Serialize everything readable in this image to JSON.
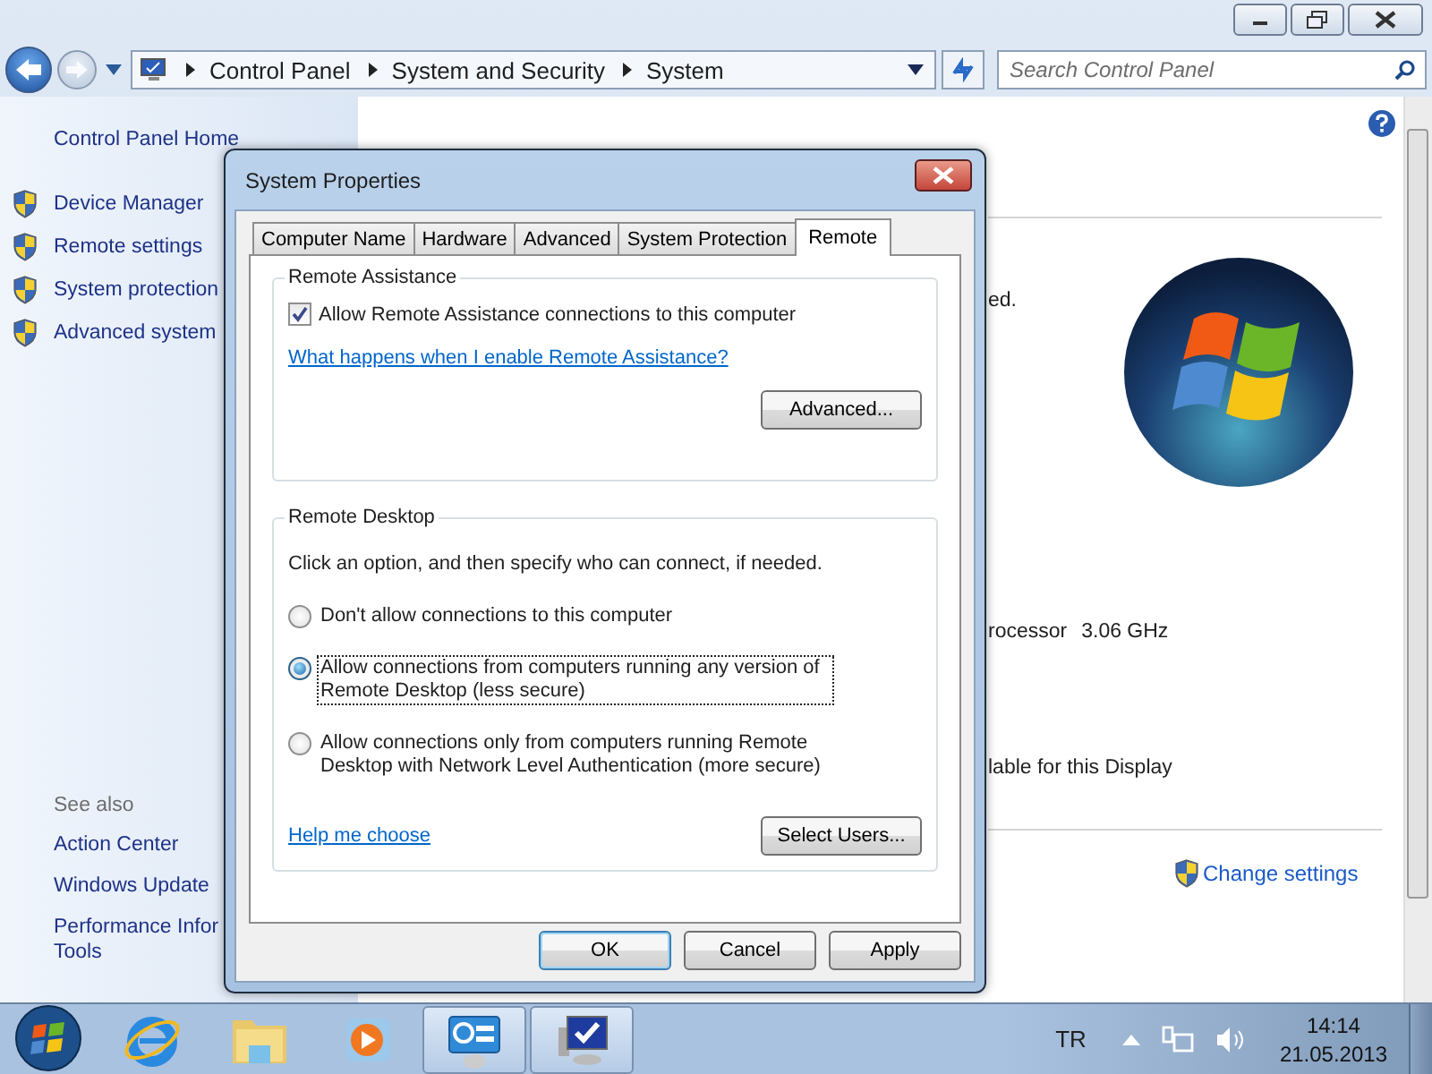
{
  "window": {
    "breadcrumb": [
      "Control Panel",
      "System and Security",
      "System"
    ],
    "search": {
      "placeholder": "Search Control Panel"
    }
  },
  "sidebar": {
    "home": "Control Panel Home",
    "tasks": [
      "Device Manager",
      "Remote settings",
      "System protection",
      "Advanced system"
    ],
    "see_also_title": "See also",
    "see_also": [
      {
        "lines": [
          "Action Center"
        ]
      },
      {
        "lines": [
          "Windows Update"
        ]
      },
      {
        "lines": [
          "Performance Infor",
          "Tools"
        ]
      }
    ]
  },
  "content": {
    "rows": [
      {
        "kind": "text",
        "text": "ed."
      },
      {
        "kind": "pair",
        "label": "rocessor",
        "value": "3.06 GHz"
      },
      {
        "kind": "text",
        "text": "lable for this Display"
      }
    ],
    "change_settings": "Change settings"
  },
  "dialog": {
    "title": "System Properties",
    "tabs": [
      {
        "label": "Computer Name",
        "selected": false
      },
      {
        "label": "Hardware",
        "selected": false
      },
      {
        "label": "Advanced",
        "selected": false
      },
      {
        "label": "System Protection",
        "selected": false
      },
      {
        "label": "Remote",
        "selected": true
      }
    ],
    "remote_assistance": {
      "title": "Remote Assistance",
      "checkbox": {
        "label": "Allow Remote Assistance connections to this computer",
        "checked": true
      },
      "link": "What happens when I enable Remote Assistance?",
      "button": "Advanced..."
    },
    "remote_desktop": {
      "title": "Remote Desktop",
      "instruction": "Click an option, and then specify who can connect, if needed.",
      "options": [
        {
          "label": "Don't allow connections to this computer",
          "selected": false
        },
        {
          "label": "Allow connections from computers running any version of Remote Desktop (less secure)",
          "selected": true
        },
        {
          "label": "Allow connections only from computers running Remote Desktop with Network Level Authentication (more secure)",
          "selected": false
        }
      ],
      "link": "Help me choose",
      "button": "Select Users..."
    },
    "buttons": [
      "OK",
      "Cancel",
      "Apply"
    ]
  },
  "taskbar": {
    "apps": [
      {
        "kind": "browser",
        "selected": false
      },
      {
        "kind": "folder",
        "selected": false
      },
      {
        "kind": "media",
        "selected": false
      },
      {
        "kind": "control-panel",
        "selected": true
      },
      {
        "kind": "system",
        "selected": true
      }
    ],
    "language": "TR",
    "time": "14:14",
    "date": "21.05.2013"
  }
}
